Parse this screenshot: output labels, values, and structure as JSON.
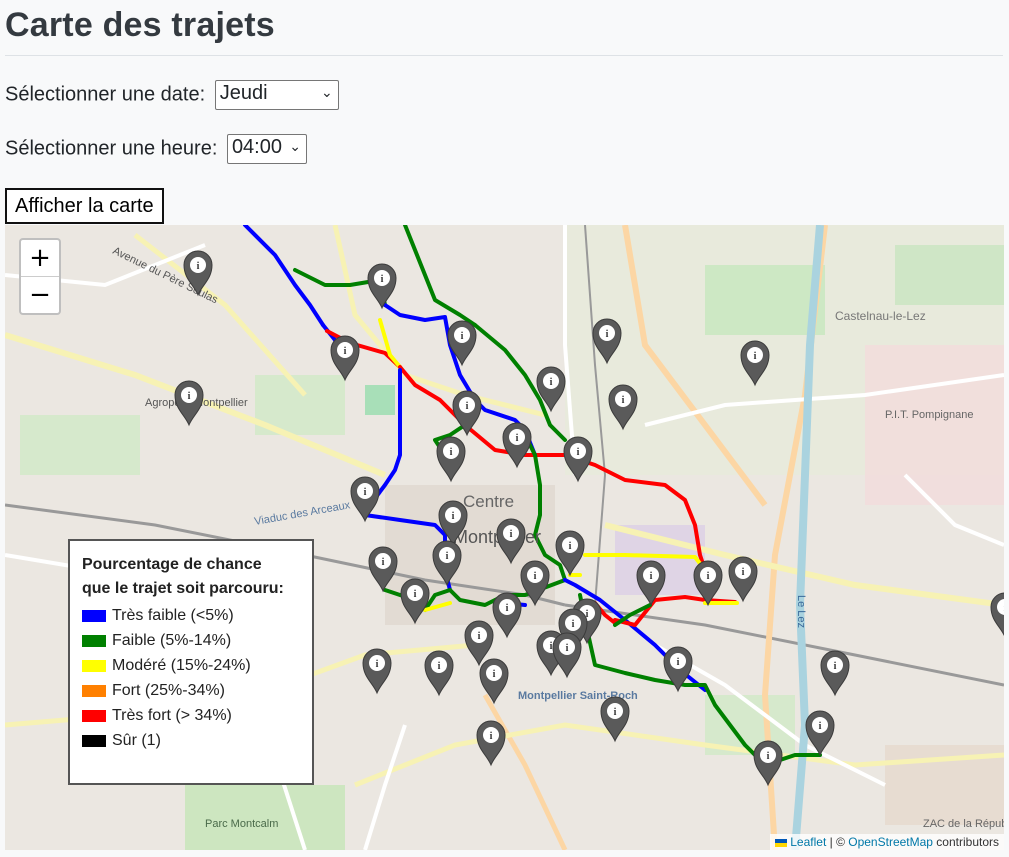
{
  "page": {
    "title": "Carte des trajets",
    "date_label": "Sélectionner une date:",
    "date_value": "Jeudi",
    "hour_label": "Sélectionner une heure:",
    "hour_value": "04:00",
    "submit_label": "Afficher la carte"
  },
  "map": {
    "zoom_in": "+",
    "zoom_out": "−",
    "labels": {
      "pere_soulas": "Avenue du Père Soulas",
      "agropolis": "Agropolis Montpellier",
      "castelnau": "Castelnau-le-Lez",
      "pit": "P.I.T. Pompignane",
      "centre": "Centre",
      "montpellier": "Montpellier",
      "arceaux": "Viaduc des Arceaux",
      "gare": "Montpellier Saint-Roch",
      "montcalm": "Parc Montcalm",
      "lez": "Le Lez",
      "zac": "ZAC de la République"
    },
    "route_colors": {
      "tres_faible": "#0000ff",
      "faible": "#008000",
      "modere": "#ffff00",
      "fort": "#ff8000",
      "tres_fort": "#ff0000",
      "sur": "#000000"
    }
  },
  "legend": {
    "title_line1": "Pourcentage de chance",
    "title_line2": "que le trajet soit parcouru:",
    "items": [
      {
        "label": "Très faible (<5%)",
        "color": "#0000ff"
      },
      {
        "label": "Faible (5%-14%)",
        "color": "#008000"
      },
      {
        "label": "Modéré (15%-24%)",
        "color": "#ffff00"
      },
      {
        "label": "Fort (25%-34%)",
        "color": "#ff8000"
      },
      {
        "label": "Très fort (> 34%)",
        "color": "#ff0000"
      },
      {
        "label": "Sûr (1)",
        "color": "#000000"
      }
    ]
  },
  "attribution": {
    "leaflet": "Leaflet",
    "separator": " | © ",
    "osm": "OpenStreetMap",
    "suffix": " contributors"
  },
  "marker_icon": "info-marker-icon"
}
